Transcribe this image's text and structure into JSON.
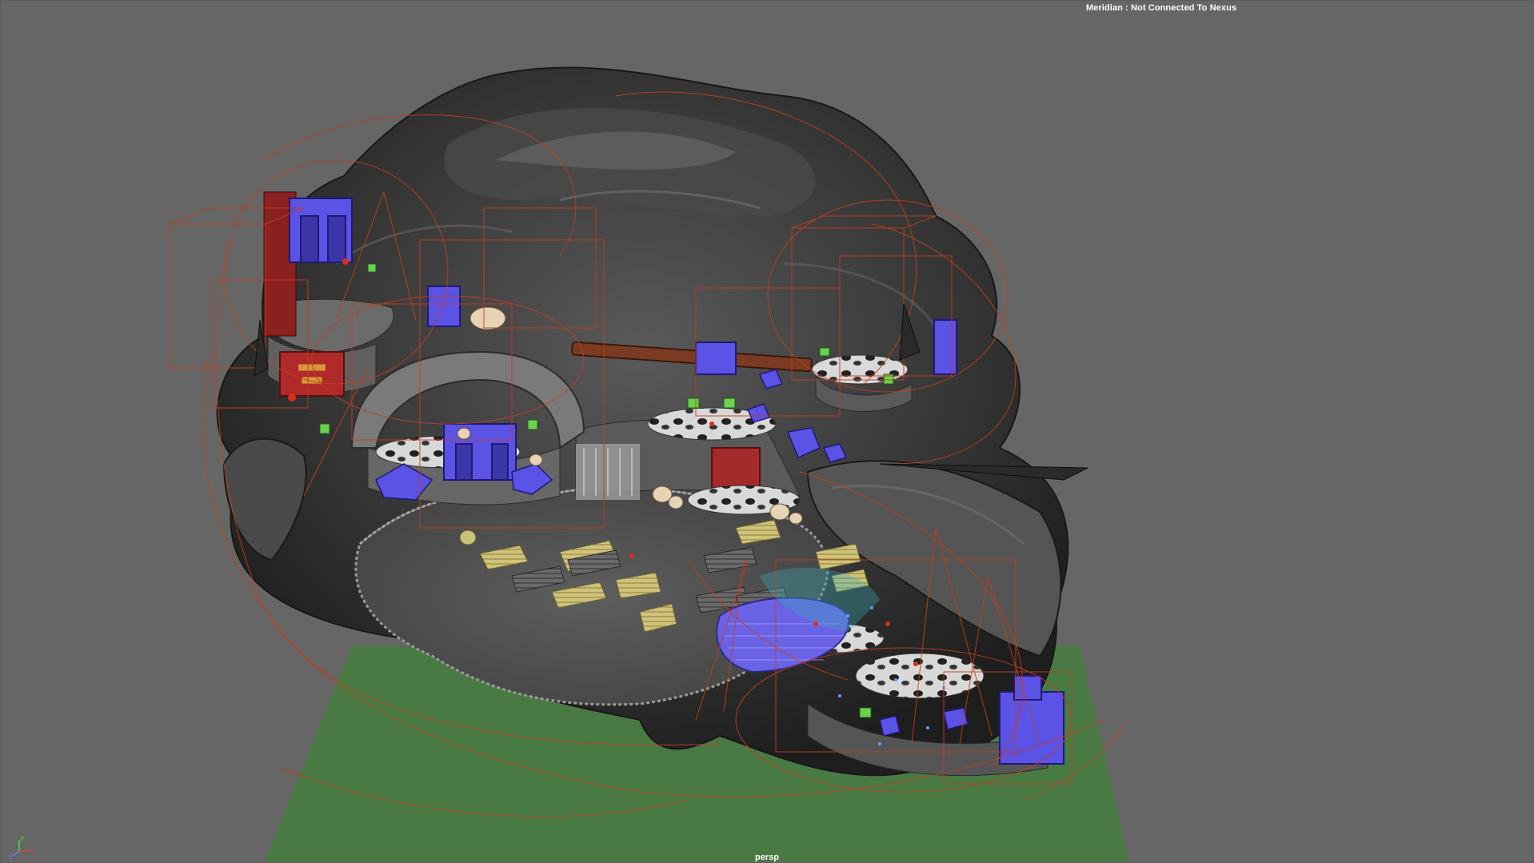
{
  "app": {
    "status_text": "Meridian : Not Connected To Nexus",
    "camera_name": "persp"
  },
  "axis_gizmo": {
    "x_label": "x",
    "y_label": "y",
    "z_label": "z",
    "colors": {
      "x": "#e04040",
      "y": "#40e040",
      "z": "#4a8cff"
    }
  },
  "scene": {
    "background_color": "#666666",
    "ground_color": "#4a7a44",
    "terrain_color": "#3c3c3c",
    "floor_color": "#5a5a5a",
    "selection_wire_color": "#c0401e",
    "proxy_color": "#5b52e6",
    "prop_color": "#c9c27a"
  }
}
